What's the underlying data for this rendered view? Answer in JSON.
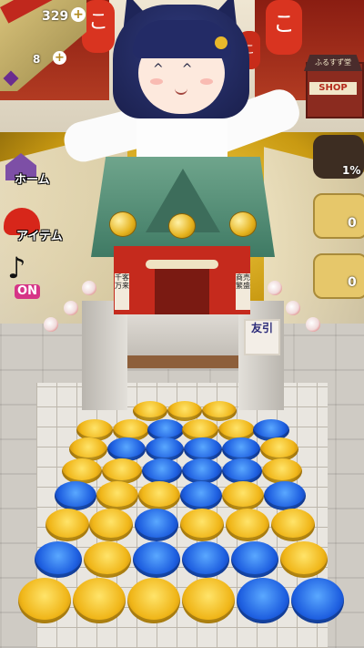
{
  "hud": {
    "coin_count": "329",
    "coin_plus": "+",
    "gem_count": "8",
    "gem_plus": "+"
  },
  "menu": {
    "home_label": "ホーム",
    "item_label": "アイテム",
    "sound_state": "ON"
  },
  "shop": {
    "roof_text": "ふるすず堂",
    "label": "SHOP"
  },
  "side": {
    "paw_percent": "1%",
    "fence_count": "0",
    "wall_count": "0"
  },
  "scene": {
    "lantern_left": "こ",
    "lantern_right": "こ",
    "lantern_small": "こ",
    "pillar_left_sign": "千客万来",
    "pillar_right_sign": "商売繁盛",
    "tomobiki_sign": "友引"
  },
  "colors": {
    "coin_gold": "#f0b619",
    "coin_blue": "#1e5fe0",
    "shrine_red": "#c52a1d",
    "roof_green": "#4f8a72"
  }
}
